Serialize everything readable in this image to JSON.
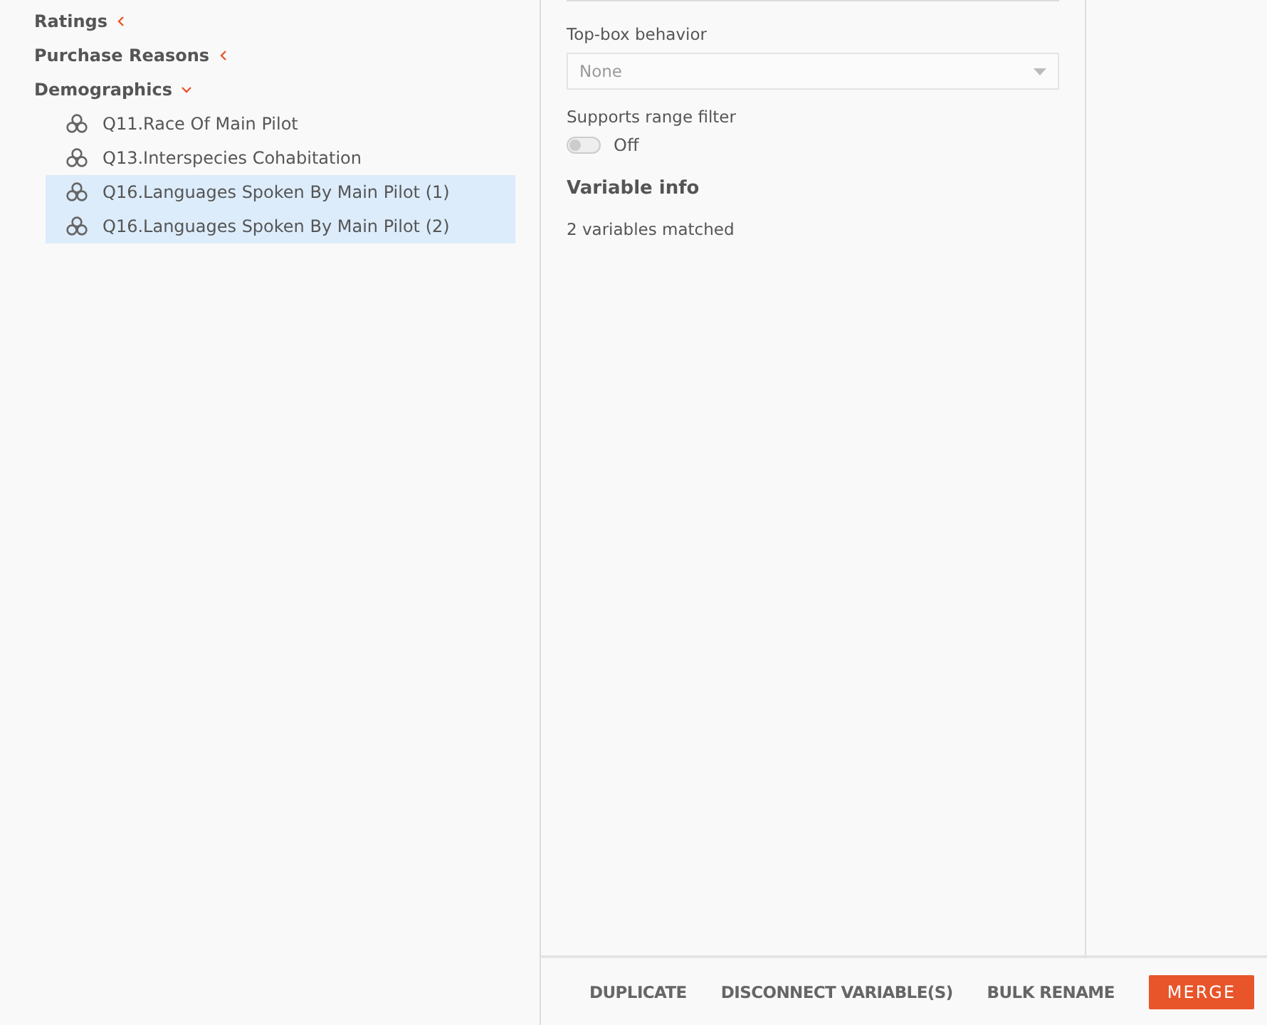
{
  "tree": [
    {
      "label": "Ratings",
      "expanded": false
    },
    {
      "label": "Purchase Reasons",
      "expanded": false
    },
    {
      "label": "Demographics",
      "expanded": true,
      "children": [
        {
          "label": "Q11.Race Of Main Pilot",
          "selected": false
        },
        {
          "label": "Q13.Interspecies Cohabitation",
          "selected": false
        },
        {
          "label": "Q16.Languages Spoken By Main Pilot (1)",
          "selected": true
        },
        {
          "label": "Q16.Languages Spoken By Main Pilot (2)",
          "selected": true
        }
      ]
    }
  ],
  "properties": {
    "topbox_label": "Top-box behavior",
    "topbox_value": "None",
    "range_label": "Supports range filter",
    "range_toggle": {
      "on": false,
      "label": "Off"
    },
    "info_heading": "Variable info",
    "info_text": "2 variables matched"
  },
  "actions": [
    {
      "label": "DUPLICATE",
      "kind": "text"
    },
    {
      "label": "DISCONNECT VARIABLE(S)",
      "kind": "text"
    },
    {
      "label": "BULK RENAME",
      "kind": "text"
    },
    {
      "label": "MERGE",
      "kind": "primary"
    }
  ]
}
